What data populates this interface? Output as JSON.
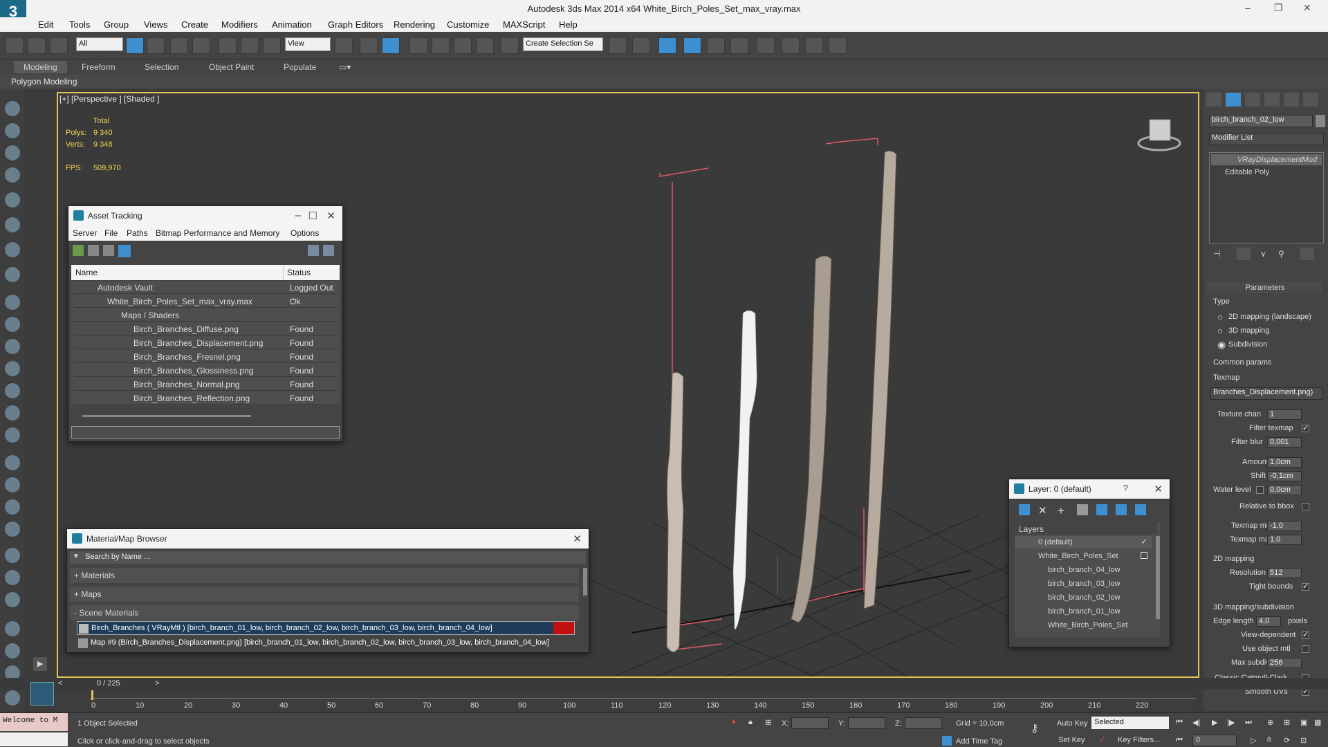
{
  "app": {
    "title": "Autodesk 3ds Max  2014 x64     White_Birch_Poles_Set_max_vray.max",
    "logo": "3"
  },
  "menu": [
    "Edit",
    "Tools",
    "Group",
    "Views",
    "Create",
    "Modifiers",
    "Animation",
    "Graph Editors",
    "Rendering",
    "Customize",
    "MAXScript",
    "Help"
  ],
  "toolbar": {
    "filter": "All",
    "refcoord": "View",
    "selset": "Create Selection Se"
  },
  "ribbon": {
    "tabs": [
      "Modeling",
      "Freeform",
      "Selection",
      "Object Paint",
      "Populate"
    ],
    "active": "Modeling",
    "sub": "Polygon Modeling"
  },
  "viewport": {
    "label": "[+] [Perspective ] [Shaded ]",
    "total": "Total",
    "polys_label": "Polys:",
    "polys": "9 340",
    "verts_label": "Verts:",
    "verts": "9 348",
    "fps_label": "FPS:",
    "fps": "509,970"
  },
  "asset_tracking": {
    "title": "Asset Tracking",
    "menu": [
      "Server",
      "File",
      "Paths",
      "Bitmap Performance and Memory",
      "Options"
    ],
    "col_name": "Name",
    "col_status": "Status",
    "rows": [
      {
        "name": "Autodesk Vault",
        "status": "Logged Out ..."
      },
      {
        "name": "White_Birch_Poles_Set_max_vray.max",
        "status": "Ok"
      },
      {
        "name": "Maps / Shaders",
        "status": ""
      },
      {
        "name": "Birch_Branches_Diffuse.png",
        "status": "Found"
      },
      {
        "name": "Birch_Branches_Displacement.png",
        "status": "Found"
      },
      {
        "name": "Birch_Branches_Fresnel.png",
        "status": "Found"
      },
      {
        "name": "Birch_Branches_Glossiness.png",
        "status": "Found"
      },
      {
        "name": "Birch_Branches_Normal.png",
        "status": "Found"
      },
      {
        "name": "Birch_Branches_Reflection.png",
        "status": "Found"
      }
    ]
  },
  "material_browser": {
    "title": "Material/Map Browser",
    "search": "Search by Name ...",
    "sections": [
      "+ Materials",
      "+ Maps",
      "- Scene Materials"
    ],
    "items": [
      "Birch_Branches  ( VRayMtl )  [birch_branch_01_low, birch_branch_02_low, birch_branch_03_low, birch_branch_04_low]",
      "Map #9 (Birch_Branches_Displacement.png)  [birch_branch_01_low, birch_branch_02_low, birch_branch_03_low, birch_branch_04_low]"
    ]
  },
  "layer": {
    "title": "Layer: 0 (default)",
    "help": "?",
    "header": "Layers",
    "items": [
      "0 (default)",
      "White_Birch_Poles_Set",
      "birch_branch_04_low",
      "birch_branch_03_low",
      "birch_branch_02_low",
      "birch_branch_01_low",
      "White_Birch_Poles_Set"
    ]
  },
  "cmd": {
    "object_name": "birch_branch_02_low",
    "modifier_list": "Modifier List",
    "stack": [
      "VRayDisplacementMod",
      "Editable Poly"
    ],
    "rollout": "Parameters",
    "type_label": "Type",
    "types": [
      "2D mapping (landscape)",
      "3D mapping",
      "Subdivision"
    ],
    "common": "Common params",
    "texmap": "Texmap",
    "texmap_val": "Branches_Displacement.png)",
    "tex_chan": "Texture chan",
    "tex_chan_v": "1",
    "filter_texmap": "Filter texmap",
    "filter_blur": "Filter blur",
    "filter_blur_v": "0,001",
    "amount": "Amount",
    "amount_v": "1,0cm",
    "shift": "Shift",
    "shift_v": "-0,1cm",
    "water": "Water level",
    "water_v": "0,0cm",
    "rel_bbox": "Relative to bbox",
    "texmin": "Texmap min",
    "texmin_v": "-1,0",
    "texmax": "Texmap max",
    "texmax_v": "1,0",
    "map2d": "2D mapping",
    "resolution": "Resolution",
    "resolution_v": "512",
    "tight": "Tight bounds",
    "map3d": "3D mapping/subdivision",
    "edge_len": "Edge length",
    "edge_len_v": "4,0",
    "pixels": "pixels",
    "view_dep": "View-dependent",
    "use_obj": "Use object mtl",
    "max_sub": "Max subdivs",
    "max_sub_v": "256",
    "catmull": "Classic Catmull-Clark",
    "smooth_uv": "Smooth UVs"
  },
  "timeline": {
    "frame": "0 / 225",
    "ticks": [
      "0",
      "10",
      "20",
      "30",
      "40",
      "50",
      "60",
      "70",
      "80",
      "90",
      "100",
      "110",
      "120",
      "130",
      "140",
      "150",
      "160",
      "170",
      "180",
      "190",
      "200",
      "210",
      "220"
    ]
  },
  "status": {
    "maxscript": "Welcome to M",
    "selected": "1 Object Selected",
    "prompt": "Click or click-and-drag to select objects",
    "x": "X:",
    "y": "Y:",
    "z": "Z:",
    "grid": "Grid = 10,0cm",
    "autokey": "Auto Key",
    "setkey": "Set Key",
    "selected_dd": "Selected",
    "key_filters": "Key Filters...",
    "add_time_tag": "Add Time Tag",
    "frame_in": "0"
  }
}
